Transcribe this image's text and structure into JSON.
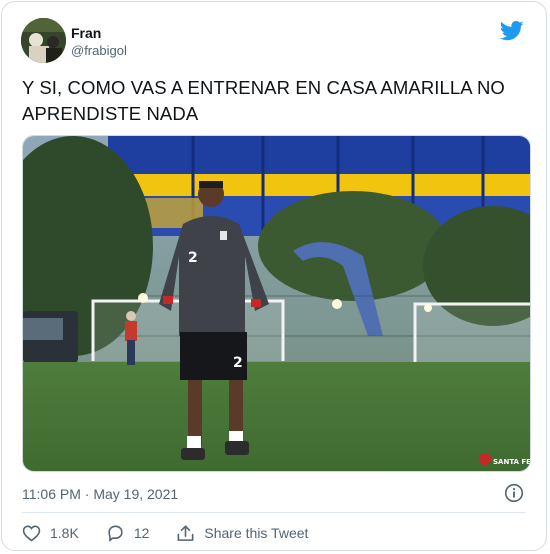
{
  "author": {
    "name": "Fran",
    "handle": "@frabigol"
  },
  "tweet": {
    "text": "Y SI, COMO VAS A ENTRENAR EN CASA AMARILLA NO APRENDISTE NADA",
    "timestamp": "11:06 PM · May 19, 2021"
  },
  "media": {
    "jersey_number": "2",
    "watermark": "SANTA FE"
  },
  "actions": {
    "like_count": "1.8K",
    "reply_count": "12",
    "share_label": "Share this Tweet"
  },
  "colors": {
    "twitter_blue": "#1d9bf0",
    "secondary_text": "#536471"
  },
  "icons": [
    "twitter-bird-icon",
    "info-icon",
    "heart-icon",
    "reply-icon",
    "share-icon"
  ]
}
